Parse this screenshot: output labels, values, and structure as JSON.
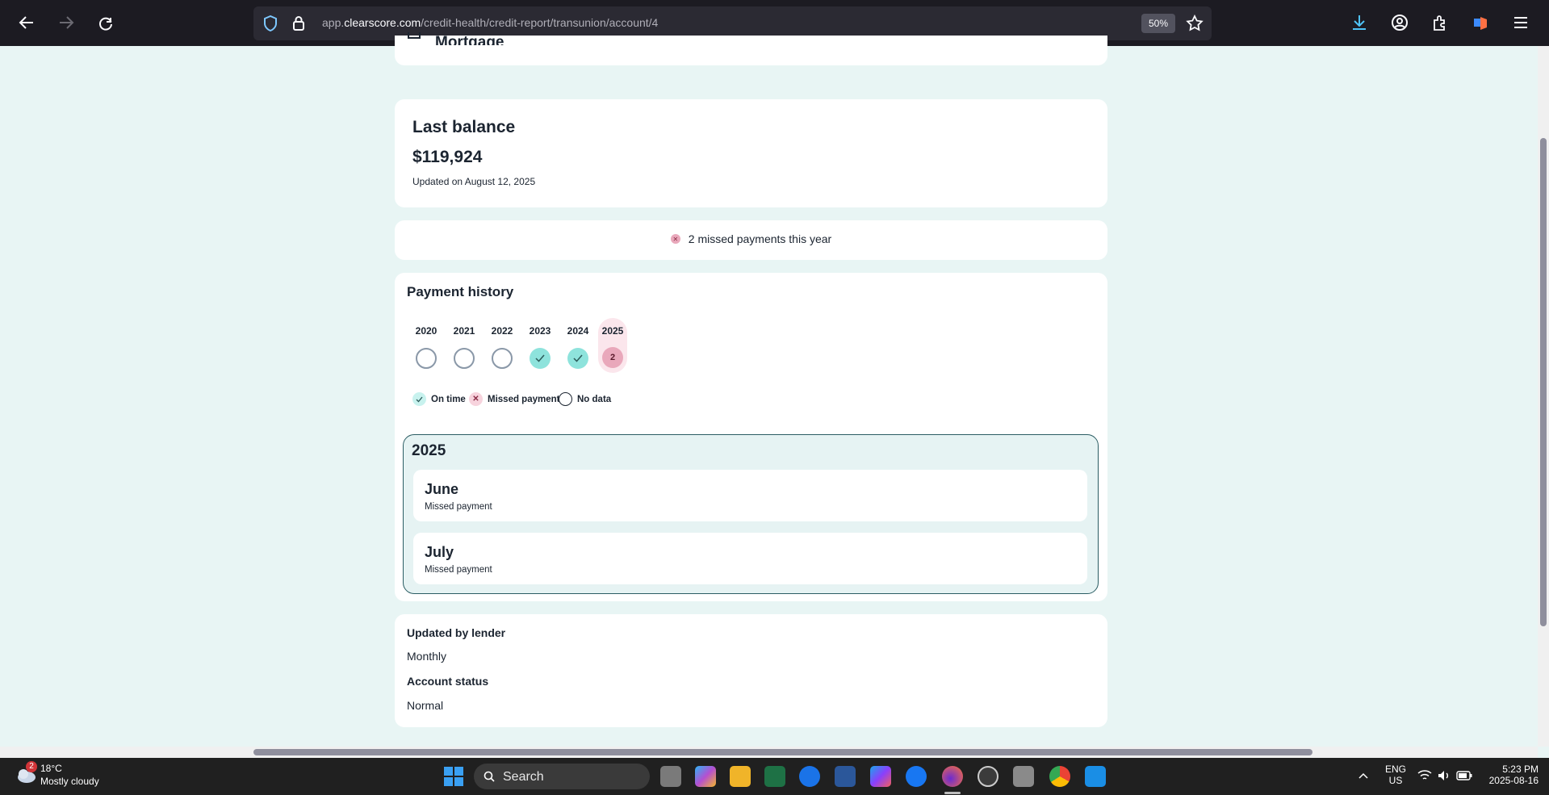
{
  "browser": {
    "url_prefix": "app.",
    "url_host": "clearscore.com",
    "url_path": "/credit-health/credit-report/transunion/account/4",
    "zoom": "50%"
  },
  "page": {
    "partial_heading": "Mortgage",
    "balance": {
      "title": "Last balance",
      "amount": "$119,924",
      "updated": "Updated on August 12, 2025"
    },
    "missed_summary": "2 missed payments this year",
    "history": {
      "title": "Payment history",
      "years": [
        {
          "year": "2020",
          "status": "none",
          "count": ""
        },
        {
          "year": "2021",
          "status": "none",
          "count": ""
        },
        {
          "year": "2022",
          "status": "none",
          "count": ""
        },
        {
          "year": "2023",
          "status": "ok",
          "count": ""
        },
        {
          "year": "2024",
          "status": "ok",
          "count": ""
        },
        {
          "year": "2025",
          "status": "missed",
          "count": "2"
        }
      ],
      "legend": {
        "on_time": "On time",
        "missed": "Missed payment",
        "no_data": "No data"
      },
      "selected_year": "2025",
      "months": [
        {
          "name": "June",
          "status": "Missed payment"
        },
        {
          "name": "July",
          "status": "Missed payment"
        }
      ]
    },
    "details": {
      "updated_label": "Updated by lender",
      "updated_value": "Monthly",
      "status_label": "Account status",
      "status_value": "Normal"
    }
  },
  "taskbar": {
    "weather_temp": "18°C",
    "weather_desc": "Mostly cloudy",
    "weather_badge": "2",
    "search_placeholder": "Search",
    "lang_top": "ENG",
    "lang_bottom": "US",
    "time": "5:23 PM",
    "date": "2025-08-16"
  },
  "colors": {
    "page_bg": "#e8f5f4",
    "on_time": "#8ee3dc",
    "missed": "#e9a8bb",
    "selected_border": "#2b5d63"
  }
}
